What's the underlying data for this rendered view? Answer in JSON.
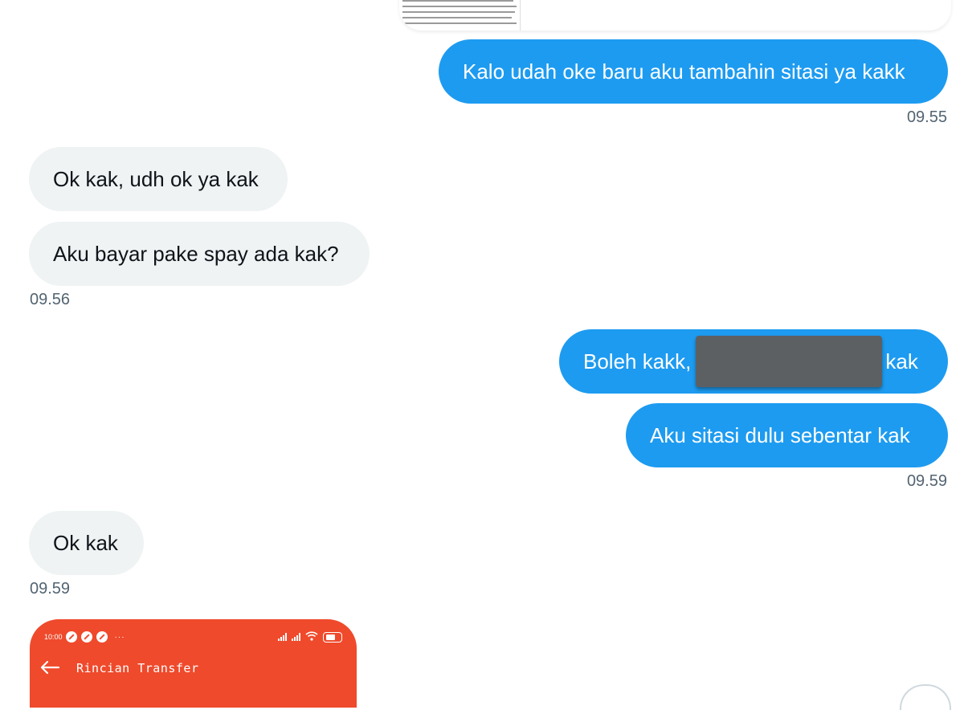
{
  "messages": [
    {
      "id": "m1",
      "text": "Kalo udah oke baru aku tambahin sitasi ya kakk"
    },
    {
      "id": "m2",
      "text": "Ok kak, udh ok ya kak"
    },
    {
      "id": "m3",
      "text": "Aku bayar pake spay ada kak?"
    },
    {
      "id": "m4",
      "text_before": "Boleh kakk,",
      "text_after": "kak"
    },
    {
      "id": "m5",
      "text": "Aku sitasi dulu sebentar kak"
    },
    {
      "id": "m6",
      "text": "Ok kak"
    }
  ],
  "timestamps": {
    "t1": "09.55",
    "t2": "09.56",
    "t3": "09.59",
    "t4": "09.59"
  },
  "attachment_screenshot": {
    "status_time": "10:00",
    "more": "···",
    "header_title": "Rincian Transfer"
  },
  "colors": {
    "outgoing": "#1d9bf0",
    "incoming": "#eff3f4",
    "app_header": "#ef4a2c"
  },
  "icons": [
    "back-arrow-icon",
    "signal-icon",
    "wifi-icon",
    "battery-icon",
    "notification-icon"
  ]
}
